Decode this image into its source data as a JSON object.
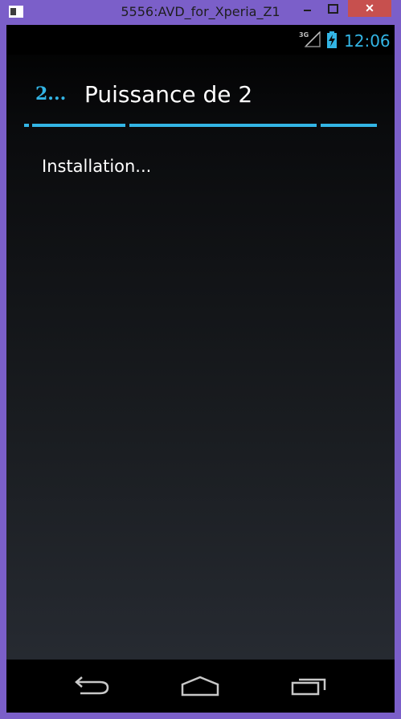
{
  "window": {
    "title": "5556:AVD_for_Xperia_Z1",
    "close_label": "✕"
  },
  "status_bar": {
    "network": "3G",
    "time": "12:06"
  },
  "action_bar": {
    "app_icon_text": "2...",
    "title": "Puissance de 2"
  },
  "content": {
    "message": "Installation..."
  },
  "colors": {
    "accent": "#33b5e5",
    "window_frame": "#7b5fc9",
    "close_button": "#c7504e"
  },
  "icons": {
    "back": "back-arrow-icon",
    "home": "home-icon",
    "recent": "recent-apps-icon",
    "signal": "signal-icon",
    "battery": "battery-charging-icon"
  }
}
